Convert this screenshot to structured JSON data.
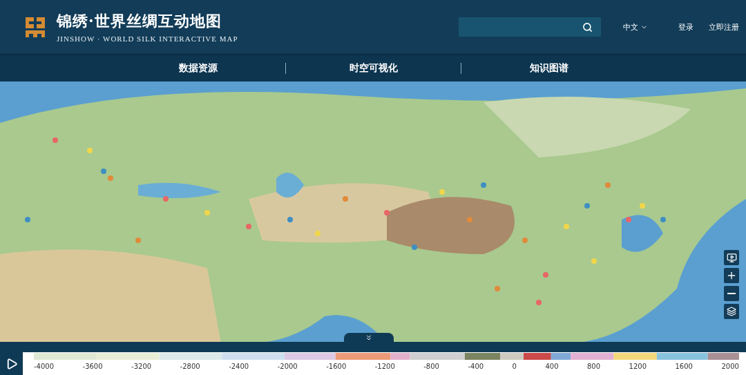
{
  "header": {
    "title": "锦绣·世界丝绸互动地图",
    "subtitle": "JINSHOW · WORLD SILK INTERACTIVE MAP",
    "language": "中文",
    "login": "登录",
    "register": "立即注册"
  },
  "nav": [
    {
      "label": "数据资源"
    },
    {
      "label": "时空可视化"
    },
    {
      "label": "知识图谱"
    }
  ],
  "timeline": {
    "ticks": [
      "-4000",
      "-3600",
      "-3200",
      "-2800",
      "-2400",
      "-2000",
      "-1600",
      "-1200",
      "-800",
      "-400",
      "0",
      "400",
      "800",
      "1200",
      "1600",
      "2000"
    ]
  }
}
